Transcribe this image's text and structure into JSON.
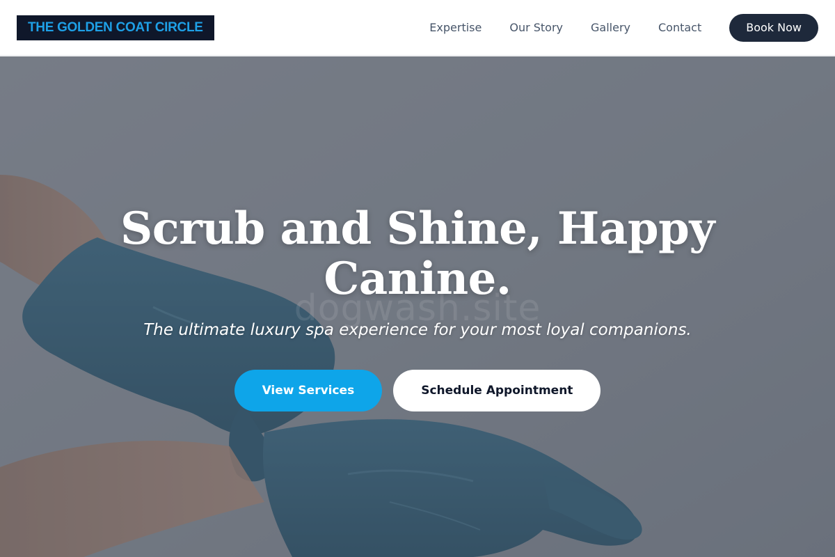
{
  "header": {
    "logo_text": "THE GOLDEN COAT CIRCLE",
    "nav": [
      {
        "label": "Expertise"
      },
      {
        "label": "Our Story"
      },
      {
        "label": "Gallery"
      },
      {
        "label": "Contact"
      }
    ],
    "book_button": "Book Now"
  },
  "hero": {
    "title_line1": "Scrub and Shine, Happy",
    "title_line2": "Canine.",
    "subtitle": "The ultimate luxury spa experience for your most loyal companions.",
    "watermark": "dogwash.site",
    "primary_button": "View Services",
    "secondary_button": "Schedule Appointment",
    "background_image": "gloved-hands-photo"
  },
  "colors": {
    "logo_bg": "#0f172a",
    "logo_text": "#1ea0e6",
    "nav_text": "#475569",
    "book_button_bg": "#1e293b",
    "primary_button_bg": "#0ea5e9",
    "secondary_button_bg": "#ffffff",
    "secondary_button_text": "#0f172a"
  }
}
